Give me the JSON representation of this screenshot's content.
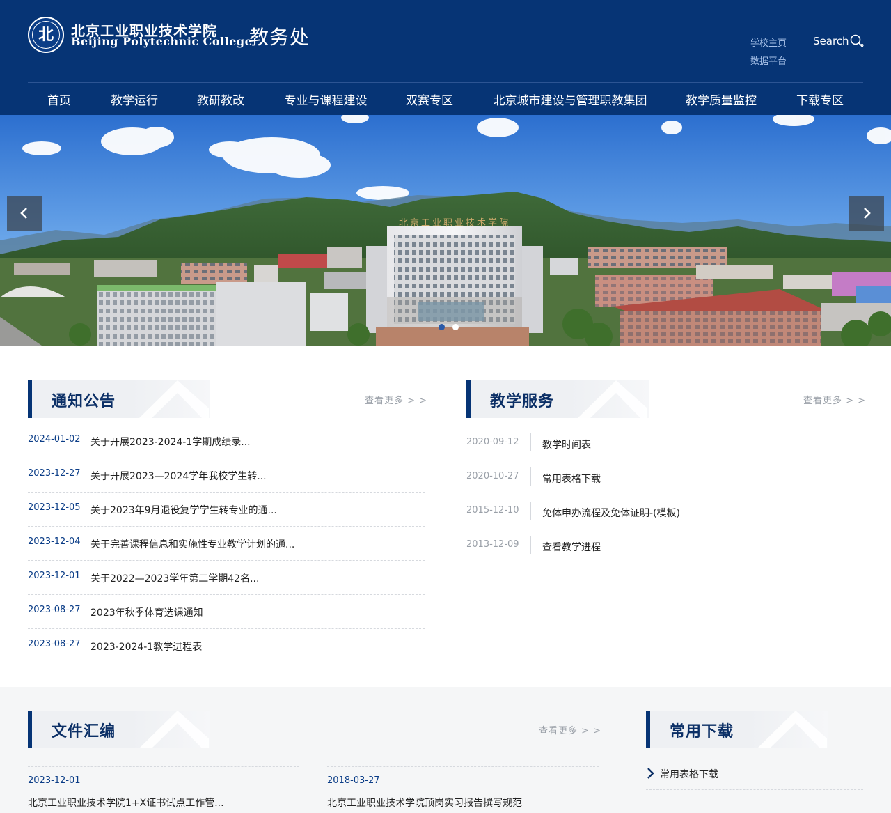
{
  "header": {
    "logo_text_cn": "北京工业职业技术学院",
    "logo_text_en": "Beijing Polytechnic College",
    "dept_title": "教务处",
    "links": [
      "学校主页",
      "数据平台"
    ],
    "search_label": "Search"
  },
  "nav": {
    "items": [
      "首页",
      "教学运行",
      "教研教改",
      "专业与课程建设",
      "双赛专区",
      "北京城市建设与管理职教集团",
      "教学质量监控",
      "下载专区"
    ]
  },
  "banner": {
    "building_sign": "北京工业职业技术学院",
    "slide_count": 2,
    "active_slide": 2
  },
  "notices": {
    "title": "通知公告",
    "more": "查看更多 > >",
    "items": [
      {
        "date": "2024-01-02",
        "title": "关于开展2023-2024-1学期成绩录..."
      },
      {
        "date": "2023-12-27",
        "title": "关于开展2023—2024学年我校学生转..."
      },
      {
        "date": "2023-12-05",
        "title": "关于2023年9月退役复学学生转专业的通..."
      },
      {
        "date": "2023-12-04",
        "title": "关于完善课程信息和实施性专业教学计划的通..."
      },
      {
        "date": "2023-12-01",
        "title": "关于2022—2023学年第二学期42名..."
      },
      {
        "date": "2023-08-27",
        "title": "2023年秋季体育选课通知"
      },
      {
        "date": "2023-08-27",
        "title": "2023-2024-1教学进程表"
      }
    ]
  },
  "services": {
    "title": "教学服务",
    "more": "查看更多 > >",
    "items": [
      {
        "date": "2020-09-12",
        "title": "教学时间表"
      },
      {
        "date": "2020-10-27",
        "title": "常用表格下载"
      },
      {
        "date": "2015-12-10",
        "title": "免体申办流程及免体证明-(模板)"
      },
      {
        "date": "2013-12-09",
        "title": "查看教学进程"
      }
    ]
  },
  "files": {
    "title": "文件汇编",
    "more": "查看更多 > >",
    "items": [
      {
        "date": "2023-12-01",
        "title": "北京工业职业技术学院1+X证书试点工作管..."
      },
      {
        "date": "2018-03-27",
        "title": "北京工业职业技术学院顶岗实习报告撰写规范"
      }
    ]
  },
  "downloads": {
    "title": "常用下载",
    "items": [
      "常用表格下载"
    ]
  },
  "colors": {
    "primary": "#063475",
    "date_blue": "#0b3d87",
    "muted": "#9aa0a8"
  }
}
